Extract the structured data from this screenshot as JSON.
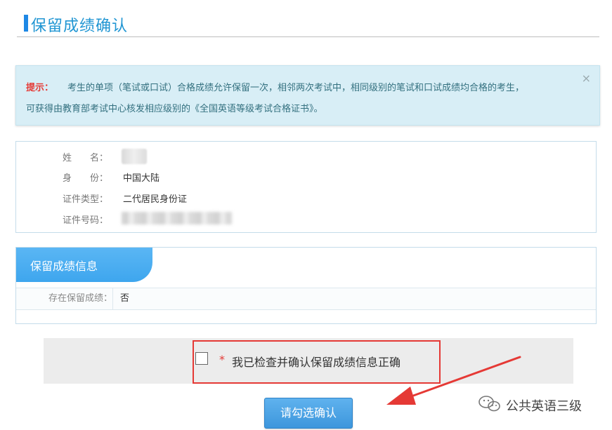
{
  "header": {
    "title": "保留成绩确认"
  },
  "alert": {
    "prefix": "提示：",
    "line1": "考生的单项（笔试或口试）合格成绩允许保留一次，相邻两次考试中，相同级别的笔试和口试成绩均合格的考生，",
    "line2": "可获得由教育部考试中心核发相应级别的《全国英语等级考试合格证书》。",
    "close": "×"
  },
  "personal": {
    "name_label": "姓　　名：",
    "identity_label": "身　　份：",
    "identity_value": "中国大陆",
    "id_type_label": "证件类型：",
    "id_type_value": "二代居民身份证",
    "id_number_label": "证件号码："
  },
  "score_info": {
    "section_title": "保留成绩信息",
    "retained_label": "存在保留成绩：",
    "retained_value": "否"
  },
  "confirm": {
    "required_mark": "*",
    "checkbox_label": "我已检查并确认保留成绩信息正确",
    "checked": false
  },
  "submit": {
    "label": "请勾选确认"
  },
  "watermark": {
    "text": "公共英语三级"
  },
  "colors": {
    "accent": "#2196d3",
    "annotation_red": "#e53935",
    "alert_bg": "#d8eef6",
    "button_blue": "#3d96dc"
  }
}
